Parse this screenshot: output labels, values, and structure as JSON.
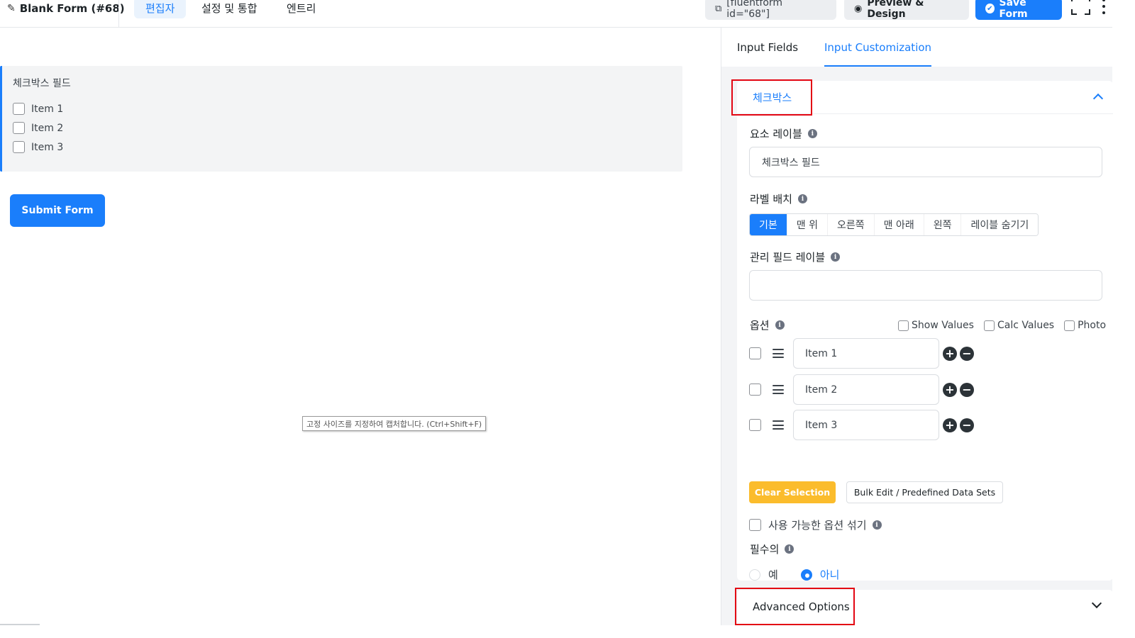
{
  "header": {
    "form_title": "Blank Form (#68)",
    "tabs": [
      {
        "label": "편집자",
        "active": true
      },
      {
        "label": "설정 및 통합",
        "active": false
      },
      {
        "label": "엔트리",
        "active": false
      }
    ],
    "shortcode": "[fluentform id=\"68\"]",
    "preview_label": "Preview & Design",
    "save_label": "Save Form"
  },
  "editor": {
    "field_label": "체크박스 필드",
    "items": [
      "Item 1",
      "Item 2",
      "Item 3"
    ],
    "submit_label": "Submit Form",
    "tooltip": "고정 사이즈를 지정하여 캡처합니다. (Ctrl+Shift+F)"
  },
  "sidebar": {
    "tabs": [
      "Input Fields",
      "Input Customization"
    ],
    "active_tab": "Input Customization",
    "section_title": "체크박스",
    "element_label": {
      "label": "요소 레이블",
      "value": "체크박스 필드"
    },
    "label_placement": {
      "label": "라벨 배치",
      "options": [
        "기본",
        "맨 위",
        "오른쪽",
        "맨 아래",
        "왼쪽",
        "레이블 숨기기"
      ],
      "selected": "기본"
    },
    "admin_field_label": {
      "label": "관리 필드 레이블",
      "value": ""
    },
    "options": {
      "label": "옵션",
      "toggles": [
        "Show Values",
        "Calc Values",
        "Photo"
      ],
      "items": [
        "Item 1",
        "Item 2",
        "Item 3"
      ]
    },
    "clear_selection_label": "Clear Selection",
    "bulk_edit_label": "Bulk Edit / Predefined Data Sets",
    "shuffle_label": "사용 가능한 옵션 섞기",
    "required": {
      "label": "필수의",
      "yes": "예",
      "no": "아니",
      "selected": "아니"
    },
    "advanced_label": "Advanced Options"
  },
  "colors": {
    "accent": "#1a7efb",
    "warning": "#fbbc2c",
    "highlight": "#e30613"
  }
}
